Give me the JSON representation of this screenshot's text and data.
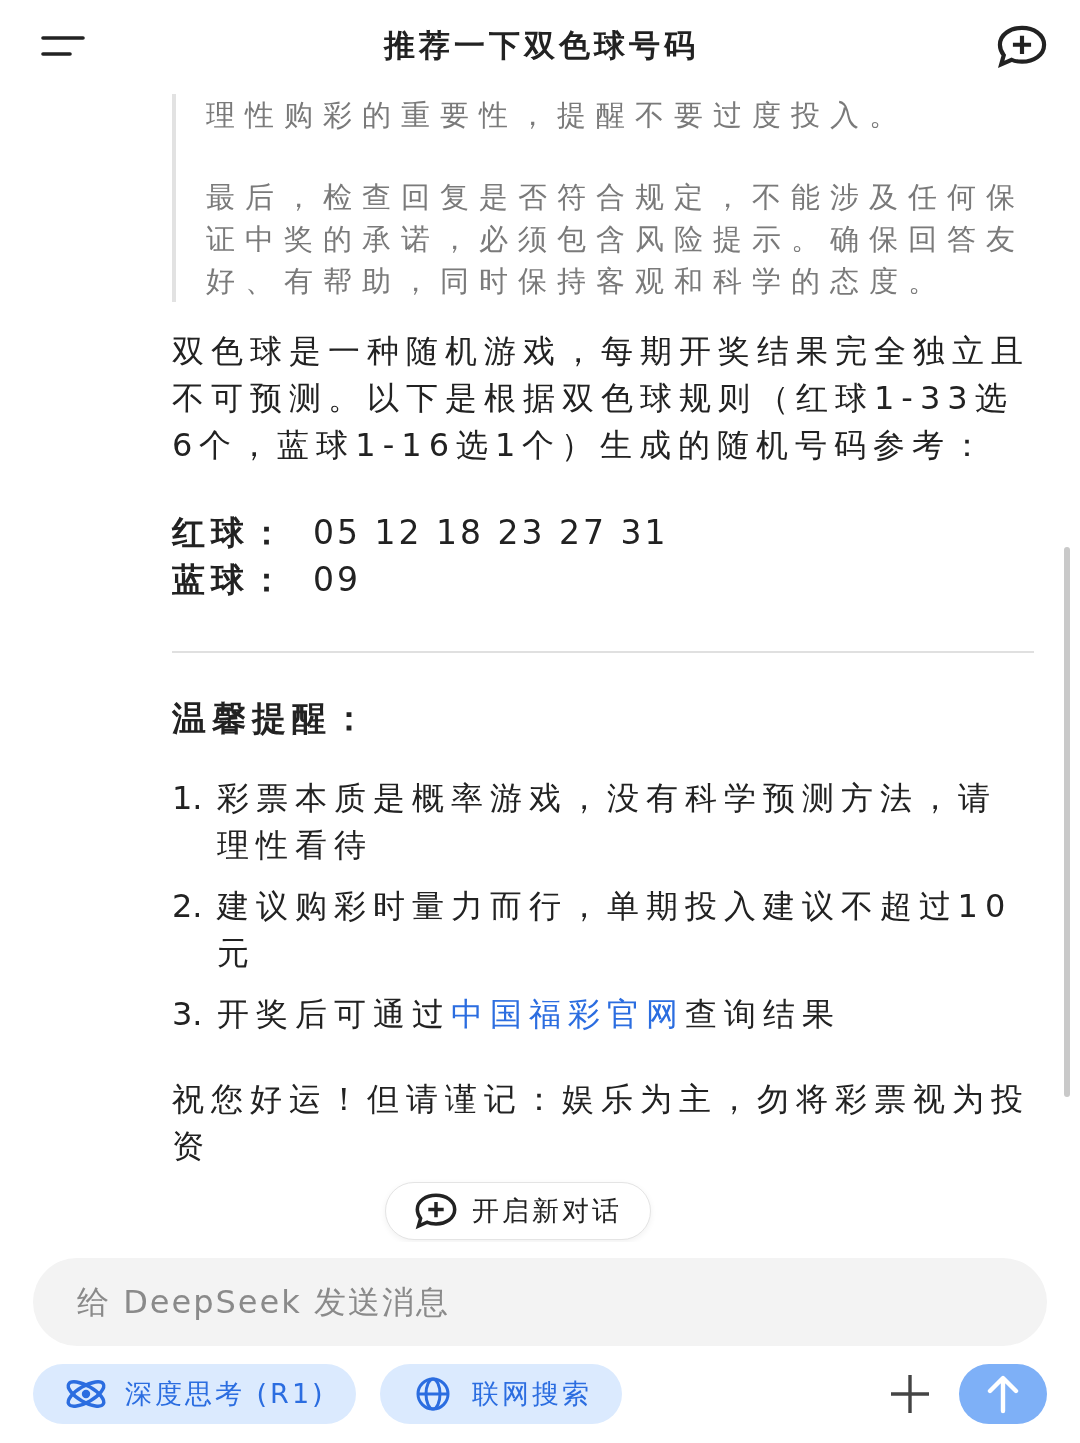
{
  "header": {
    "title": "推荐一下双色球号码"
  },
  "thinking": {
    "paragraphs": [
      "理性购彩的重要性，提醒不要过度投入。",
      "最后，检查回复是否符合规定，不能涉及任何保证中奖的承诺，必须包含风险提示。确保回答友好、有帮助，同时保持客观和科学的态度。"
    ]
  },
  "answer": {
    "intro": "双色球是一种随机游戏，每期开奖结果完全独立且不可预测。以下是根据双色球规则（红球1-33选6个，蓝球1-16选1个）生成的随机号码参考：",
    "balls": [
      {
        "label": "红球：",
        "value": "05 12 18 23 27 31"
      },
      {
        "label": "蓝球：",
        "value": "09"
      }
    ],
    "heading": "温馨提醒：",
    "tips": [
      {
        "number": "1.",
        "text": "彩票本质是概率游戏，没有科学预测方法，请理性看待"
      },
      {
        "number": "2.",
        "text": "建议购彩时量力而行，单期投入建议不超过10元"
      },
      {
        "number": "3.",
        "text": "开奖后可通过",
        "link": "中国福彩官网",
        "after": "查询结果"
      }
    ],
    "closing": "祝您好运！但请谨记：娱乐为主，勿将彩票视为投资"
  },
  "new_chat_button": {
    "label": "开启新对话"
  },
  "composer": {
    "placeholder": "给 DeepSeek 发送消息",
    "toggles": [
      {
        "kind": "deepthink",
        "label": "深度思考 (R1)",
        "selected": true
      },
      {
        "kind": "search",
        "label": "联网搜索",
        "selected": true
      }
    ]
  }
}
